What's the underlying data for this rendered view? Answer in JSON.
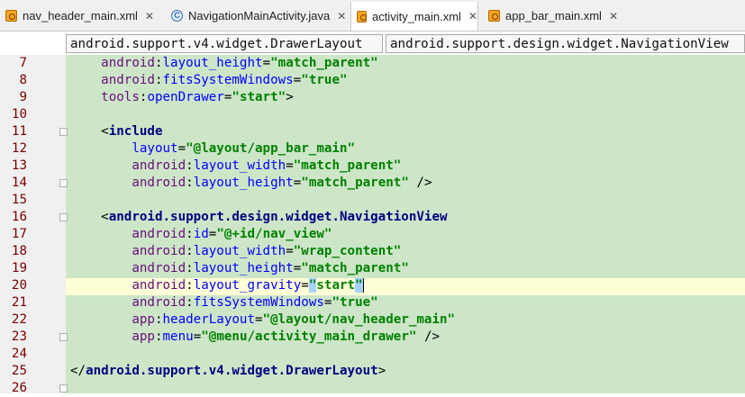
{
  "tabs": [
    {
      "label": "nav_header_main.xml",
      "icon": "xml-file-icon",
      "active": false
    },
    {
      "label": "NavigationMainActivity.java",
      "icon": "java-class-icon",
      "active": false
    },
    {
      "label": "activity_main.xml",
      "icon": "xml-file-icon",
      "active": true
    },
    {
      "label": "app_bar_main.xml",
      "icon": "xml-file-icon",
      "active": false
    }
  ],
  "close_glyph": "✕",
  "breadcrumbs": [
    "android.support.v4.widget.DrawerLayout",
    "android.support.design.widget.NavigationView"
  ],
  "editor": {
    "current_line": 20,
    "lines": [
      {
        "n": "7",
        "text": "    android:layout_height=\"match_parent\""
      },
      {
        "n": "8",
        "text": "    android:fitsSystemWindows=\"true\""
      },
      {
        "n": "9",
        "text": "    tools:openDrawer=\"start\">"
      },
      {
        "n": "10",
        "text": ""
      },
      {
        "n": "11",
        "text": "    <include"
      },
      {
        "n": "12",
        "text": "        layout=\"@layout/app_bar_main\""
      },
      {
        "n": "13",
        "text": "        android:layout_width=\"match_parent\""
      },
      {
        "n": "14",
        "text": "        android:layout_height=\"match_parent\" />"
      },
      {
        "n": "15",
        "text": ""
      },
      {
        "n": "16",
        "text": "    <android.support.design.widget.NavigationView"
      },
      {
        "n": "17",
        "text": "        android:id=\"@+id/nav_view\""
      },
      {
        "n": "18",
        "text": "        android:layout_width=\"wrap_content\""
      },
      {
        "n": "19",
        "text": "        android:layout_height=\"match_parent\""
      },
      {
        "n": "20",
        "text": "        android:layout_gravity=\"start\""
      },
      {
        "n": "21",
        "text": "        android:fitsSystemWindows=\"true\""
      },
      {
        "n": "22",
        "text": "        app:headerLayout=\"@layout/nav_header_main\""
      },
      {
        "n": "23",
        "text": "        app:menu=\"@menu/activity_main_drawer\" />"
      },
      {
        "n": "24",
        "text": ""
      },
      {
        "n": "25",
        "text": "</android.support.v4.widget.DrawerLayout>"
      },
      {
        "n": "26",
        "text": ""
      }
    ]
  }
}
